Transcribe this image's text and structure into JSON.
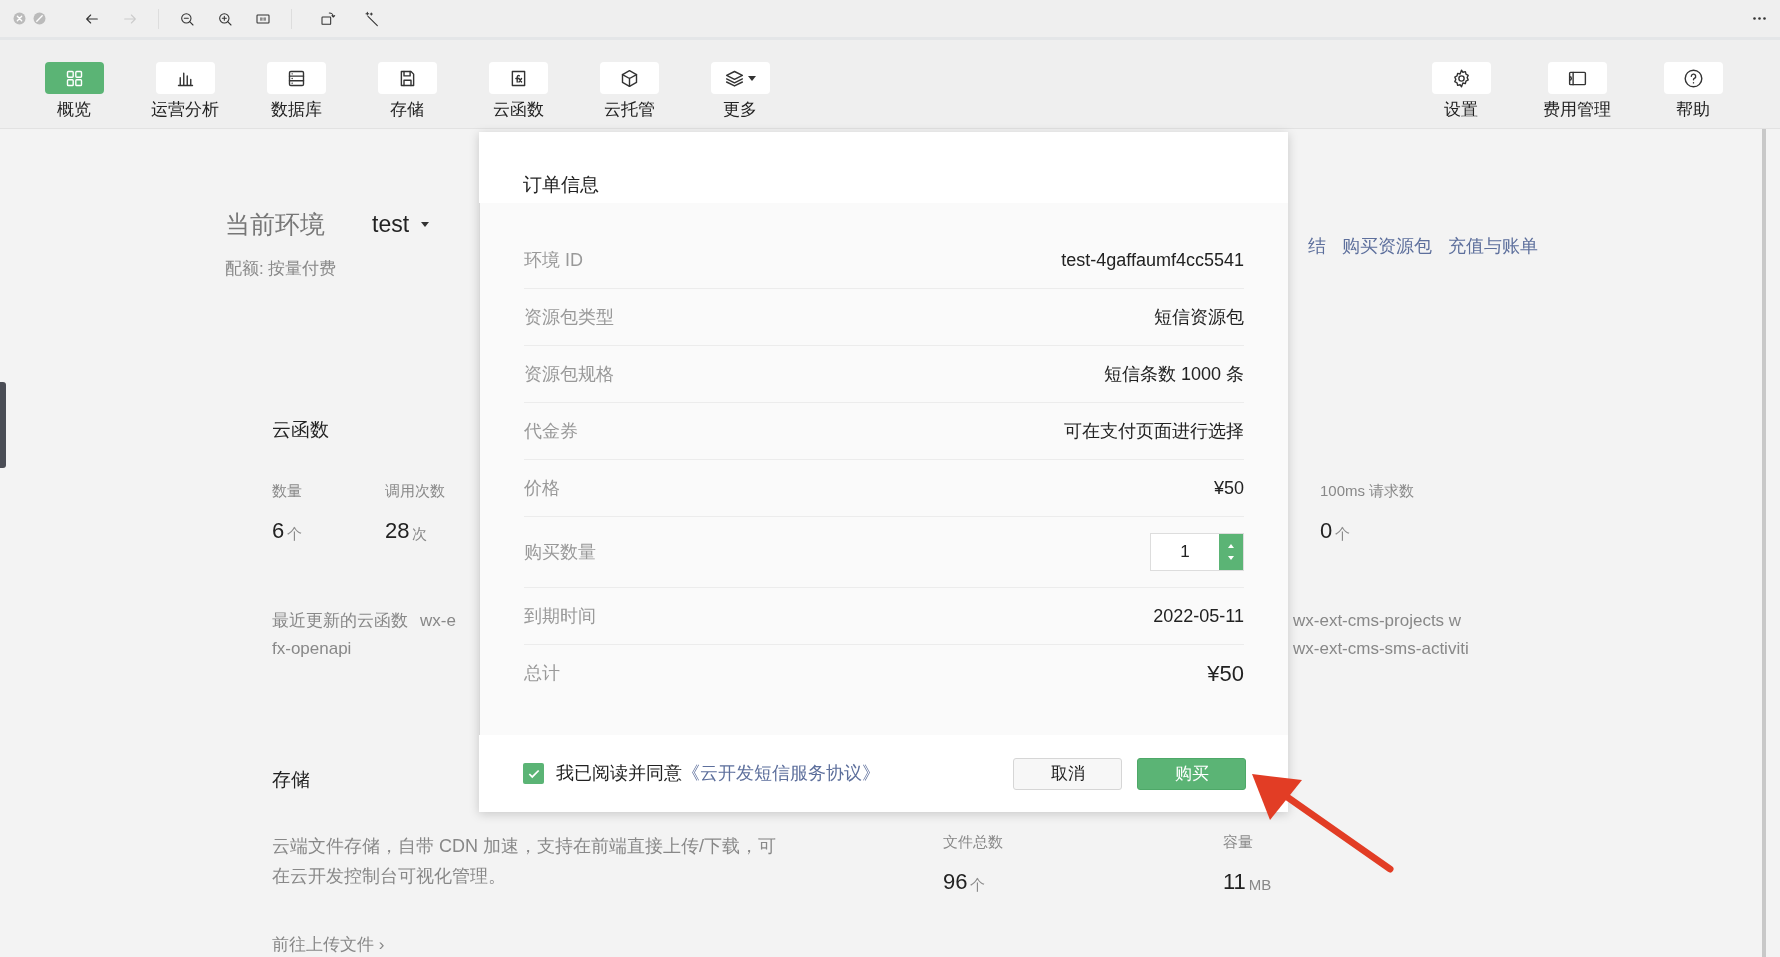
{
  "navigation": [
    {
      "disabled": false
    },
    {
      "disabled": true
    }
  ],
  "toolbar": {
    "left": [
      {
        "label": "概览",
        "selected": true
      },
      {
        "label": "运营分析",
        "selected": false
      },
      {
        "label": "数据库",
        "selected": false
      },
      {
        "label": "存储",
        "selected": false
      },
      {
        "label": "云函数",
        "selected": false
      },
      {
        "label": "云托管",
        "selected": false
      },
      {
        "label": "更多",
        "selected": false
      }
    ],
    "right": [
      {
        "label": "设置"
      },
      {
        "label": "费用管理"
      },
      {
        "label": "帮助"
      }
    ]
  },
  "environment": {
    "label": "当前环境",
    "value": "test",
    "quota": "配额: 按量付费",
    "links": [
      "结",
      "购买资源包",
      "充值与账单"
    ]
  },
  "functions": {
    "title": "云函数",
    "stats": [
      {
        "label": "数量",
        "value": "6",
        "unit": "个"
      },
      {
        "label": "调用次数",
        "value": "28",
        "unit": "次"
      },
      {
        "label": "100ms 请求数",
        "value": "0",
        "unit": "个"
      }
    ],
    "recent_label": "最近更新的云函数",
    "recent_left": [
      "wx-e",
      "fx-openapi"
    ],
    "recent_right": [
      "wx-ext-cms-projects w",
      "wx-ext-cms-sms-activiti"
    ]
  },
  "storage": {
    "title": "存储",
    "description": "云端文件存储，自带 CDN 加速，支持在前端直接上传/下载，可在云开发控制台可视化管理。",
    "stats": [
      {
        "label": "文件总数",
        "value": "96",
        "unit": "个"
      },
      {
        "label": "容量",
        "value": "11",
        "unit": "MB"
      }
    ],
    "link": "前往上传文件 ›"
  },
  "dialog": {
    "title": "订单信息",
    "rows": [
      {
        "kind": "text",
        "label": "环境 ID",
        "value": "test-4gaffaumf4cc5541"
      },
      {
        "kind": "text",
        "label": "资源包类型",
        "value": "短信资源包"
      },
      {
        "kind": "text",
        "label": "资源包规格",
        "value": "短信条数 1000 条"
      },
      {
        "kind": "text",
        "label": "代金券",
        "value": "可在支付页面进行选择"
      },
      {
        "kind": "text",
        "label": "价格",
        "value": "¥50"
      },
      {
        "kind": "stepper",
        "label": "购买数量",
        "value": "1"
      },
      {
        "kind": "text",
        "label": "到期时间",
        "value": "2022-05-11"
      },
      {
        "kind": "total",
        "label": "总计",
        "value": "¥50"
      }
    ],
    "agreement": {
      "checked": true,
      "text": "我已阅读并同意",
      "link": "《云开发短信服务协议》"
    },
    "buttons": [
      {
        "kind": "secondary",
        "label": "取消"
      },
      {
        "kind": "primary",
        "label": "购买"
      }
    ]
  }
}
